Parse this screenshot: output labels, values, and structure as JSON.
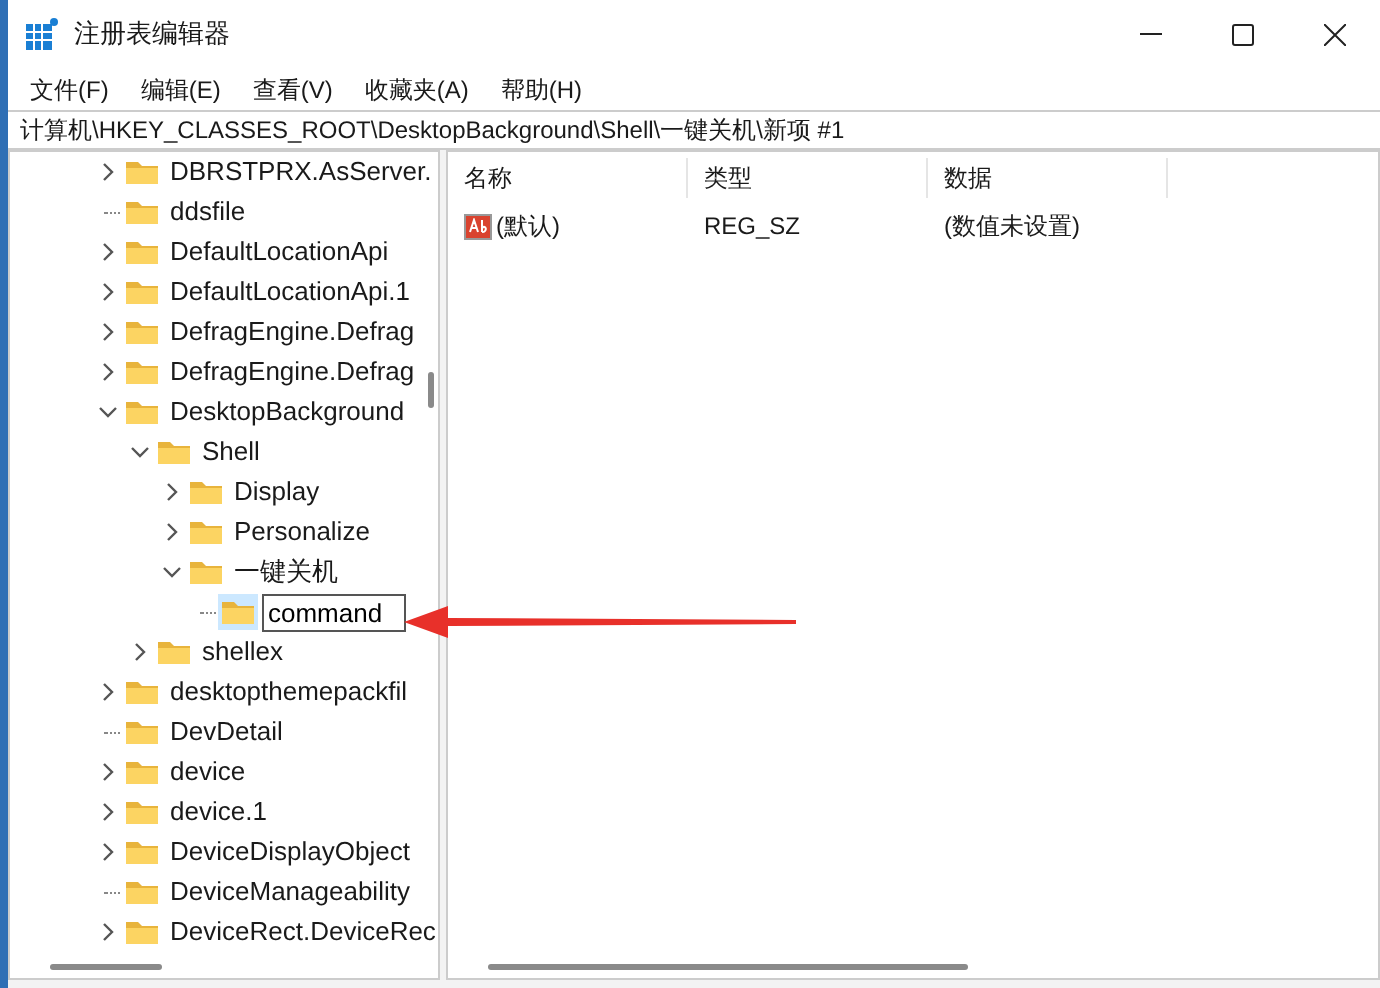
{
  "window": {
    "title": "注册表编辑器"
  },
  "menu": [
    "文件(F)",
    "编辑(E)",
    "查看(V)",
    "收藏夹(A)",
    "帮助(H)"
  ],
  "address": "计算机\\HKEY_CLASSES_ROOT\\DesktopBackground\\Shell\\一键关机\\新项 #1",
  "tree": [
    {
      "label": "DBRSTPRX.AsServer.",
      "kind": "branch",
      "expanded": false,
      "selected": false
    },
    {
      "label": "ddsfile",
      "kind": "leaf",
      "selected": false
    },
    {
      "label": "DefaultLocationApi",
      "kind": "branch",
      "expanded": false,
      "selected": false
    },
    {
      "label": "DefaultLocationApi.1",
      "kind": "branch",
      "expanded": false,
      "selected": false
    },
    {
      "label": "DefragEngine.Defrag",
      "kind": "branch",
      "expanded": false,
      "selected": false
    },
    {
      "label": "DefragEngine.Defrag",
      "kind": "branch",
      "expanded": false,
      "selected": false
    },
    {
      "label": "DesktopBackground",
      "kind": "branch",
      "expanded": true,
      "selected": false,
      "children": [
        {
          "label": "Shell",
          "kind": "branch",
          "expanded": true,
          "selected": false,
          "children": [
            {
              "label": "Display",
              "kind": "branch",
              "expanded": false,
              "selected": false
            },
            {
              "label": "Personalize",
              "kind": "branch",
              "expanded": false,
              "selected": false
            },
            {
              "label": "一键关机",
              "kind": "branch",
              "expanded": true,
              "selected": false,
              "children": [
                {
                  "label": "command",
                  "kind": "leaf",
                  "selected": true,
                  "editing": true
                }
              ]
            }
          ]
        },
        {
          "label": "shellex",
          "kind": "branch",
          "expanded": false,
          "selected": false
        }
      ]
    },
    {
      "label": "desktopthemepackfil",
      "kind": "branch",
      "expanded": false,
      "selected": false
    },
    {
      "label": "DevDetail",
      "kind": "leaf",
      "selected": false
    },
    {
      "label": "device",
      "kind": "branch",
      "expanded": false,
      "selected": false
    },
    {
      "label": "device.1",
      "kind": "branch",
      "expanded": false,
      "selected": false
    },
    {
      "label": "DeviceDisplayObject",
      "kind": "branch",
      "expanded": false,
      "selected": false
    },
    {
      "label": "DeviceManageability",
      "kind": "leaf",
      "selected": false
    },
    {
      "label": "DeviceRect.DeviceRec",
      "kind": "branch",
      "expanded": false,
      "selected": false
    }
  ],
  "table": {
    "columns": [
      "名称",
      "类型",
      "数据"
    ],
    "rows": [
      {
        "name": "(默认)",
        "type": "REG_SZ",
        "data": "(数值未设置)"
      }
    ]
  }
}
